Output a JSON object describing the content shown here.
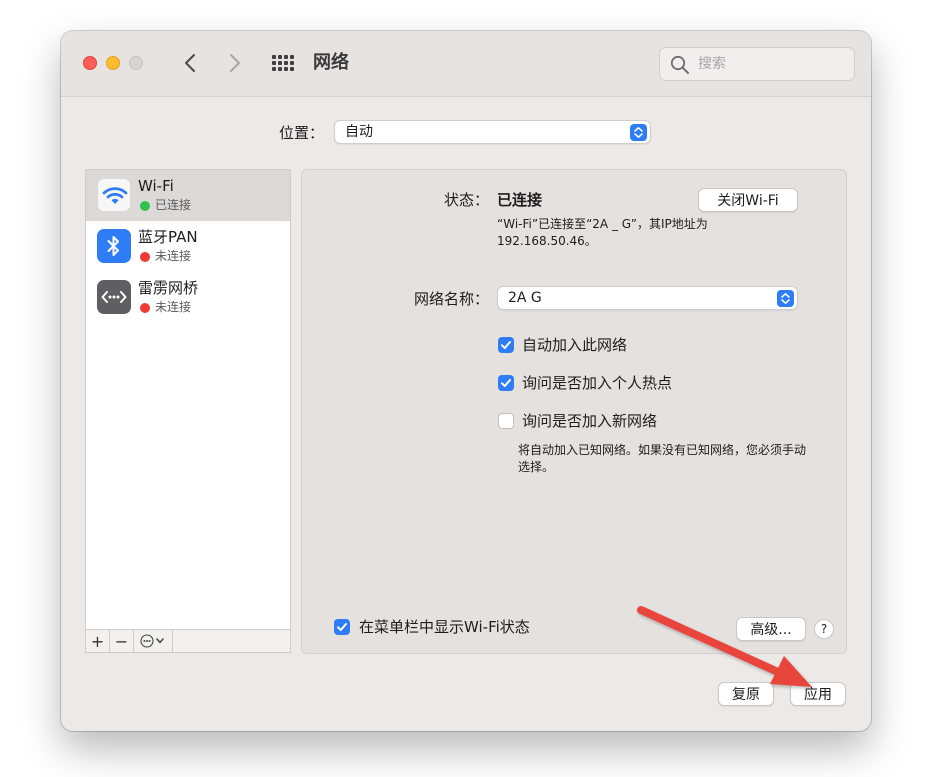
{
  "window": {
    "title": "网络",
    "search_placeholder": "搜索"
  },
  "location": {
    "label": "位置：",
    "value": "自动"
  },
  "services": [
    {
      "name": "Wi-Fi",
      "status": "已连接",
      "status_color": "#2fc14b",
      "icon": "wifi-icon",
      "selected": true
    },
    {
      "name": "蓝牙PAN",
      "status": "未连接",
      "status_color": "#ee3b33",
      "icon": "bluetooth-icon",
      "selected": false
    },
    {
      "name": "雷雳网桥",
      "status": "未连接",
      "status_color": "#ee3b33",
      "icon": "thunderbolt-bridge-icon",
      "selected": false
    }
  ],
  "sidebar_toolbar": {
    "add": "+",
    "remove": "−"
  },
  "detail": {
    "status_label": "状态：",
    "status_value": "已连接",
    "turn_off_button": "关闭Wi-Fi",
    "status_description": "“Wi-Fi”已连接至“2A _ G”，其IP地址为192.168.50.46。",
    "network_name_label": "网络名称：",
    "network_name_value": "2A G",
    "options": [
      {
        "label": "自动加入此网络",
        "checked": true
      },
      {
        "label": "询问是否加入个人热点",
        "checked": true
      },
      {
        "label": "询问是否加入新网络",
        "checked": false
      }
    ],
    "hint": "将自动加入已知网络。如果没有已知网络，您必须手动选择。",
    "show_in_menubar": {
      "label": "在菜单栏中显示Wi-Fi状态",
      "checked": true
    },
    "advanced_button": "高级...",
    "help_button": "?"
  },
  "footer": {
    "revert_button": "复原",
    "apply_button": "应用"
  },
  "colors": {
    "accent": "#2f7df6",
    "annotation_arrow": "#e8453c"
  }
}
